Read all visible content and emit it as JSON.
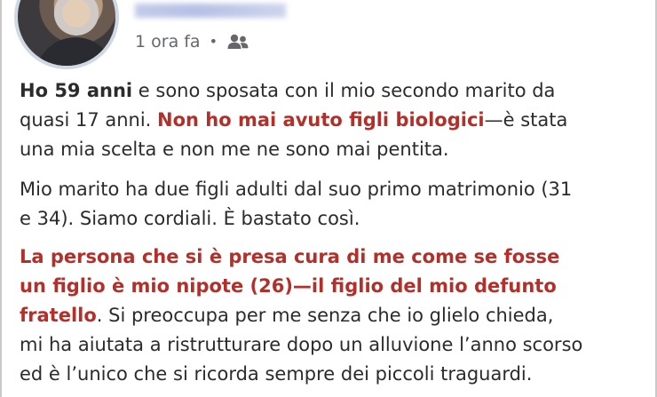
{
  "post": {
    "timestamp": "1 ora fa",
    "separator": "•",
    "audience_icon": "friends-icon",
    "paragraph1": {
      "line1_bold": "Ho 59 anni",
      "line1_rest": " e sono sposata con il mio secondo marito da",
      "line2_start": "quasi 17 anni. ",
      "line2_red": "Non ho mai avuto figli biologici",
      "line2_rest": "—è stata",
      "line3": "una mia scelta e non me ne sono mai pentita."
    },
    "paragraph2": {
      "line1": "Mio marito ha due figli adulti dal suo primo matrimonio (31",
      "line2": "e 34). Siamo cordiali. È bastato così."
    },
    "paragraph3": {
      "line1_red": "La persona che si è presa cura di me come se fosse",
      "line2_red": "un figlio è mio nipote (26)—il figlio del mio defunto",
      "line3_red": "fratello",
      "line3_rest": ". Si preoccupa per me senza che io glielo chieda,",
      "line4": "mi ha aiutata a ristrutturare dopo un alluvione l’anno scorso",
      "line5": "ed è l’unico che si ricorda sempre dei piccoli traguardi."
    }
  },
  "colors": {
    "highlight_red": "#b32f2a",
    "meta_gray": "#65676b",
    "body_text": "#2b2b2b"
  }
}
